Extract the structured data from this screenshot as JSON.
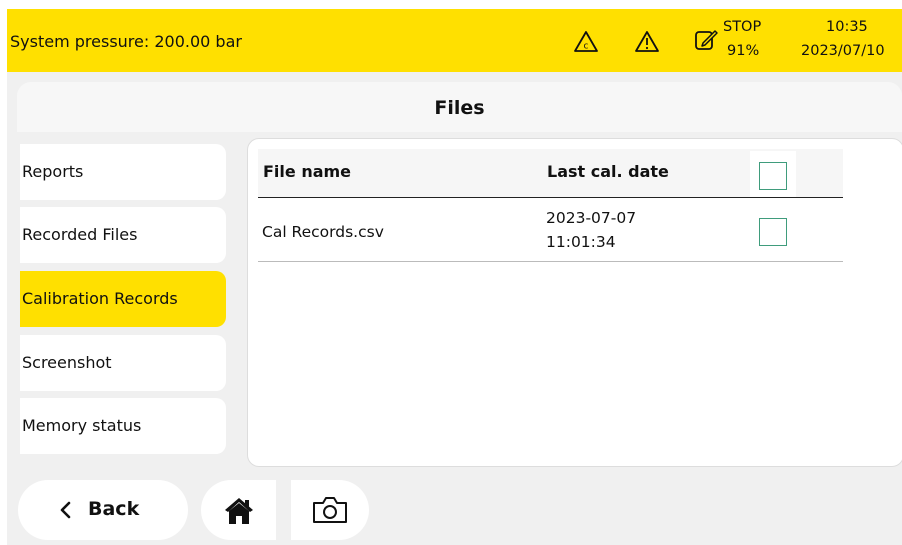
{
  "colors": {
    "accent_yellow": "#ffe000",
    "checkbox_green": "#3f9c7c",
    "app_background": "#f0f0f0"
  },
  "status_bar": {
    "system_pressure_text": "System pressure: 200.00 bar",
    "icons": [
      "calibration-warning-icon",
      "warning-icon",
      "edit-note-icon"
    ],
    "state_text": "STOP",
    "battery_text": "91%",
    "time": "10:35",
    "date": "2023/07/10"
  },
  "page": {
    "title": "Files"
  },
  "sidebar": {
    "items": [
      {
        "label": "Reports",
        "active": false
      },
      {
        "label": "Recorded Files",
        "active": false
      },
      {
        "label": "Calibration Records",
        "active": true
      },
      {
        "label": "Screenshot",
        "active": false
      },
      {
        "label": "Memory status",
        "active": false
      }
    ]
  },
  "table": {
    "columns": [
      "File name",
      "Last cal. date"
    ],
    "select_all_checked": false,
    "rows": [
      {
        "file_name": "Cal Records.csv",
        "date": "2023-07-07",
        "time": "11:01:34",
        "checked": false
      }
    ]
  },
  "bottom_bar": {
    "back_label": "Back",
    "icons": [
      "chevron-left-icon",
      "home-icon",
      "camera-icon"
    ]
  }
}
